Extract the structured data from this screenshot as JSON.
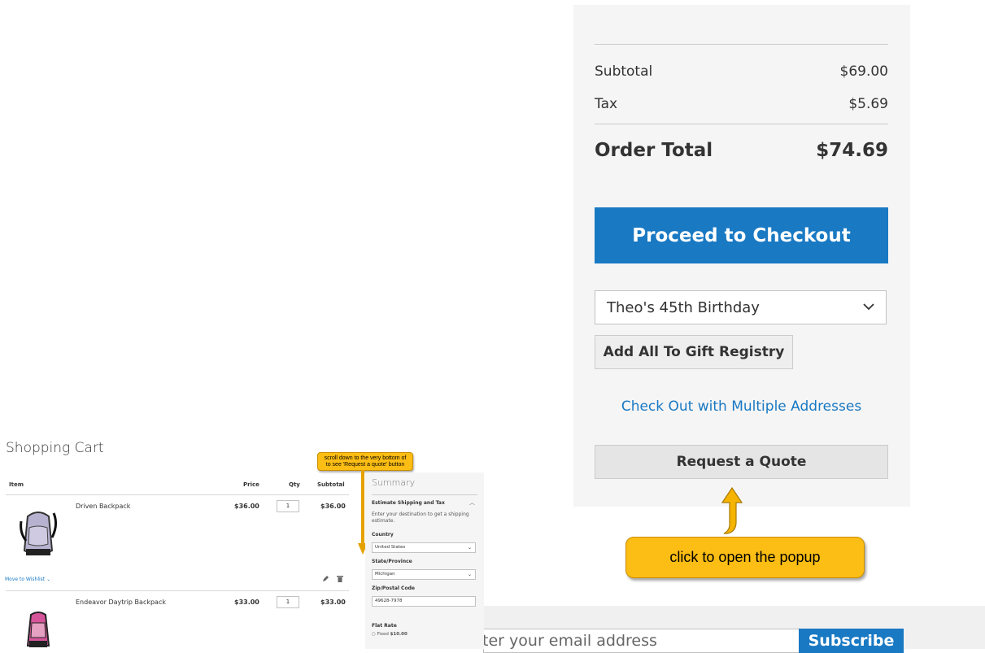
{
  "summary": {
    "subtotal_label": "Subtotal",
    "subtotal_value": "$69.00",
    "tax_label": "Tax",
    "tax_value": "$5.69",
    "order_total_label": "Order Total",
    "order_total_value": "$74.69",
    "checkout_label": "Proceed to Checkout",
    "registry_selected": "Theo's 45th Birthday",
    "add_registry_label": "Add All To Gift Registry",
    "multi_address_label": "Check Out with Multiple Addresses",
    "request_quote_label": "Request a Quote"
  },
  "annotations": {
    "popup_hint": "click to open the popup",
    "scroll_hint_line1": "scroll down to the very bottom of",
    "scroll_hint_line2": "to see 'Request a quote' button"
  },
  "newsletter": {
    "placeholder": "Enter your email address",
    "subscribe_label": "Subscribe"
  },
  "cart": {
    "title": "Shopping Cart",
    "headers": {
      "item": "Item",
      "price": "Price",
      "qty": "Qty",
      "subtotal": "Subtotal"
    },
    "items": [
      {
        "name": "Driven Backpack",
        "price": "$36.00",
        "qty": "1",
        "subtotal": "$36.00"
      },
      {
        "name": "Endeavor Daytrip Backpack",
        "price": "$33.00",
        "qty": "1",
        "subtotal": "$33.00"
      }
    ],
    "move_to_wishlist": "Move to Wishlist"
  },
  "mini_summary": {
    "title": "Summary",
    "estimate_label": "Estimate Shipping and Tax",
    "estimate_text": "Enter your destination to get a shipping estimate.",
    "country_label": "Country",
    "country_value": "United States",
    "state_label": "State/Province",
    "state_value": "Michigan",
    "zip_label": "Zip/Postal Code",
    "zip_value": "49628-7978",
    "flat_rate_label": "Flat Rate",
    "fixed_label": "Fixed",
    "fixed_value": "$10.00"
  },
  "colors": {
    "primary_blue": "#1979c3",
    "callout_yellow": "#fcbd14",
    "arrow_orange": "#e5a100"
  }
}
